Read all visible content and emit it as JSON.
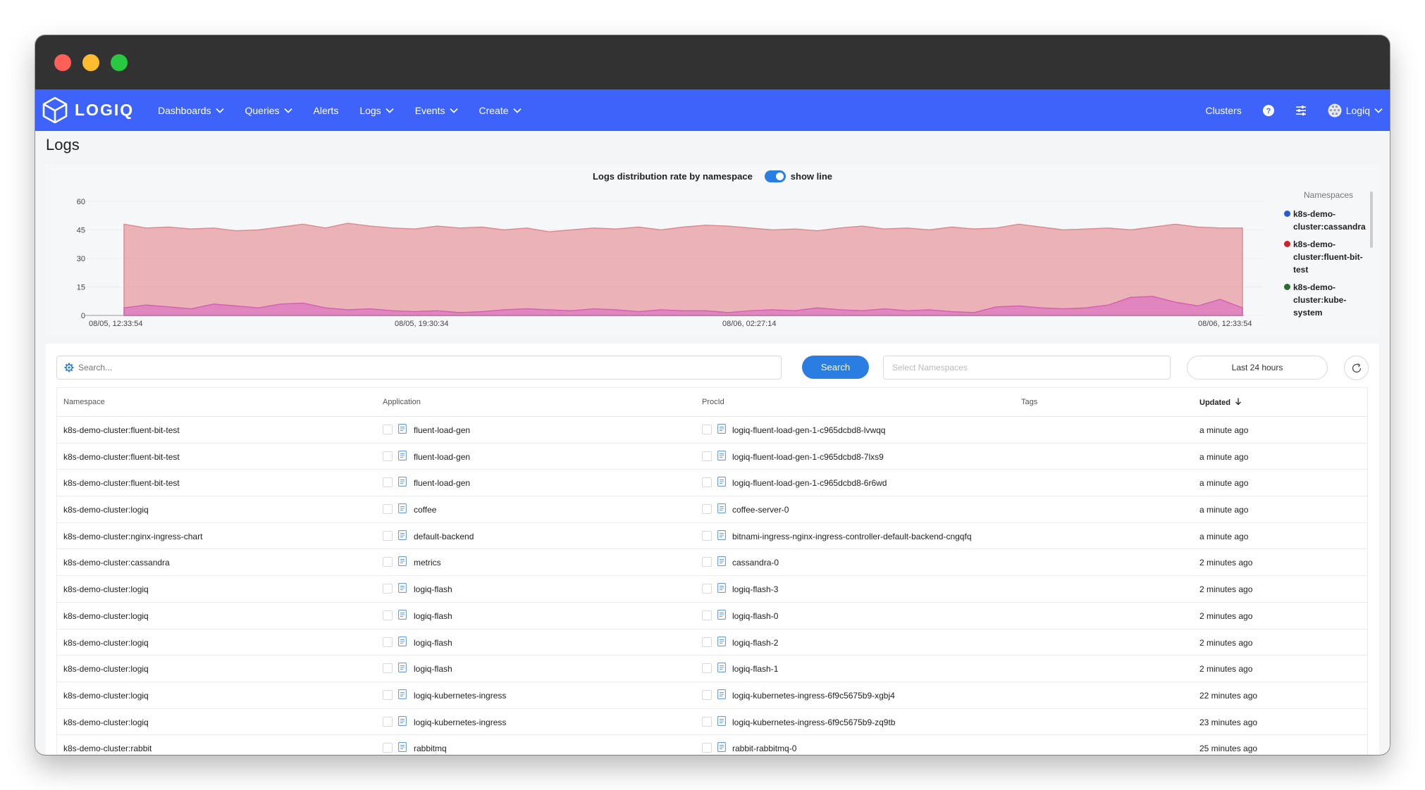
{
  "brand": {
    "name": "LOGIQ"
  },
  "nav": {
    "items": [
      {
        "label": "Dashboards",
        "dropdown": true
      },
      {
        "label": "Queries",
        "dropdown": true
      },
      {
        "label": "Alerts",
        "dropdown": false
      },
      {
        "label": "Logs",
        "dropdown": true
      },
      {
        "label": "Events",
        "dropdown": true
      },
      {
        "label": "Create",
        "dropdown": true
      }
    ],
    "right": {
      "clusters": "Clusters",
      "user": "Logiq"
    }
  },
  "page": {
    "title": "Logs"
  },
  "chart": {
    "title": "Logs distribution rate by namespace",
    "toggle_label": "show line",
    "toggle_on": true,
    "legend_title": "Namespaces",
    "legend": [
      {
        "label": "k8s-demo-cluster:cassandra",
        "line1": "k8s-demo-",
        "line2": "cluster:cassandra",
        "color": "#2a5bd7"
      },
      {
        "label": "k8s-demo-cluster:fluent-bit-test",
        "line1": "k8s-demo-",
        "line2": "cluster:fluent-bit-test",
        "color": "#d0202a"
      },
      {
        "label": "k8s-demo-cluster:kube-system",
        "line1": "k8s-demo-",
        "line2": "cluster:kube-system",
        "color": "#2e6b2e"
      }
    ]
  },
  "chart_data": {
    "type": "area",
    "title": "Logs distribution rate by namespace",
    "ylim": [
      0,
      60
    ],
    "yticks": [
      0,
      15,
      30,
      45,
      60
    ],
    "xticks": [
      "08/05, 12:33:54",
      "08/05, 19:30:34",
      "08/06, 02:27:14",
      "08/06, 12:33:54"
    ],
    "legend_position": "right",
    "series": [
      {
        "name": "k8s-demo-cluster:fluent-bit-test",
        "color": "#e9a7ab",
        "values": [
          48,
          46,
          46.5,
          45.5,
          46,
          44.5,
          45,
          46.5,
          48,
          46,
          48.5,
          47,
          46,
          45.5,
          47,
          46,
          46.5,
          45,
          46,
          44,
          45,
          46,
          45.5,
          46.5,
          45,
          46.5,
          47.5,
          47,
          46,
          45,
          45.5,
          44.5,
          46,
          47,
          45.5,
          46,
          45,
          46.5,
          45.5,
          46,
          48,
          46.5,
          45,
          45.5,
          46,
          45,
          46.5,
          48,
          46.5,
          46,
          46
        ]
      },
      {
        "name": "k8s-demo-cluster:cassandra",
        "color": "#e080c0",
        "values": [
          4,
          5.5,
          4.5,
          3.5,
          6,
          5,
          4,
          6,
          6.5,
          4,
          3,
          3.5,
          2.5,
          2,
          2.5,
          1.5,
          2,
          3,
          3.5,
          3,
          2.5,
          3.5,
          3,
          2,
          3,
          2.5,
          2.5,
          1.5,
          2.5,
          3,
          2.5,
          4,
          3,
          2.5,
          3.5,
          2.5,
          3,
          2,
          1.5,
          4.5,
          5,
          4,
          3.5,
          4,
          5.5,
          9.5,
          10,
          7,
          5,
          8.5,
          4
        ]
      },
      {
        "name": "k8s-demo-cluster:kube-system",
        "color": "#2e6b2e",
        "values": [
          0,
          0,
          0,
          0,
          0,
          0,
          0,
          0,
          0,
          0,
          0,
          0,
          0,
          0,
          0,
          0,
          0,
          0,
          0,
          0,
          0,
          0,
          0,
          0,
          0,
          0,
          0,
          0,
          0,
          0,
          0,
          0,
          0,
          0,
          0,
          0,
          0,
          0,
          0,
          0,
          0,
          0,
          0,
          0,
          0,
          0,
          0,
          0,
          0,
          0,
          0
        ]
      }
    ]
  },
  "controls": {
    "search_placeholder": "Search...",
    "search_button": "Search",
    "namespace_placeholder": "Select Namespaces",
    "time_range": "Last 24 hours"
  },
  "table": {
    "headers": {
      "namespace": "Namespace",
      "application": "Application",
      "procid": "ProcId",
      "tags": "Tags",
      "updated": "Updated"
    },
    "rows": [
      {
        "namespace": "k8s-demo-cluster:fluent-bit-test",
        "application": "fluent-load-gen",
        "procid": "logiq-fluent-load-gen-1-c965dcbd8-lvwqq",
        "updated": "a minute ago"
      },
      {
        "namespace": "k8s-demo-cluster:fluent-bit-test",
        "application": "fluent-load-gen",
        "procid": "logiq-fluent-load-gen-1-c965dcbd8-7lxs9",
        "updated": "a minute ago"
      },
      {
        "namespace": "k8s-demo-cluster:fluent-bit-test",
        "application": "fluent-load-gen",
        "procid": "logiq-fluent-load-gen-1-c965dcbd8-6r6wd",
        "updated": "a minute ago"
      },
      {
        "namespace": "k8s-demo-cluster:logiq",
        "application": "coffee",
        "procid": "coffee-server-0",
        "updated": "a minute ago"
      },
      {
        "namespace": "k8s-demo-cluster:nginx-ingress-chart",
        "application": "default-backend",
        "procid": "bitnami-ingress-nginx-ingress-controller-default-backend-cngqfq",
        "updated": "a minute ago"
      },
      {
        "namespace": "k8s-demo-cluster:cassandra",
        "application": "metrics",
        "procid": "cassandra-0",
        "updated": "2 minutes ago"
      },
      {
        "namespace": "k8s-demo-cluster:logiq",
        "application": "logiq-flash",
        "procid": "logiq-flash-3",
        "updated": "2 minutes ago"
      },
      {
        "namespace": "k8s-demo-cluster:logiq",
        "application": "logiq-flash",
        "procid": "logiq-flash-0",
        "updated": "2 minutes ago"
      },
      {
        "namespace": "k8s-demo-cluster:logiq",
        "application": "logiq-flash",
        "procid": "logiq-flash-2",
        "updated": "2 minutes ago"
      },
      {
        "namespace": "k8s-demo-cluster:logiq",
        "application": "logiq-flash",
        "procid": "logiq-flash-1",
        "updated": "2 minutes ago"
      },
      {
        "namespace": "k8s-demo-cluster:logiq",
        "application": "logiq-kubernetes-ingress",
        "procid": "logiq-kubernetes-ingress-6f9c5675b9-xgbj4",
        "updated": "22 minutes ago"
      },
      {
        "namespace": "k8s-demo-cluster:logiq",
        "application": "logiq-kubernetes-ingress",
        "procid": "logiq-kubernetes-ingress-6f9c5675b9-zq9tb",
        "updated": "23 minutes ago"
      },
      {
        "namespace": "k8s-demo-cluster:rabbit",
        "application": "rabbitmq",
        "procid": "rabbit-rabbitmq-0",
        "updated": "25 minutes ago"
      }
    ]
  }
}
